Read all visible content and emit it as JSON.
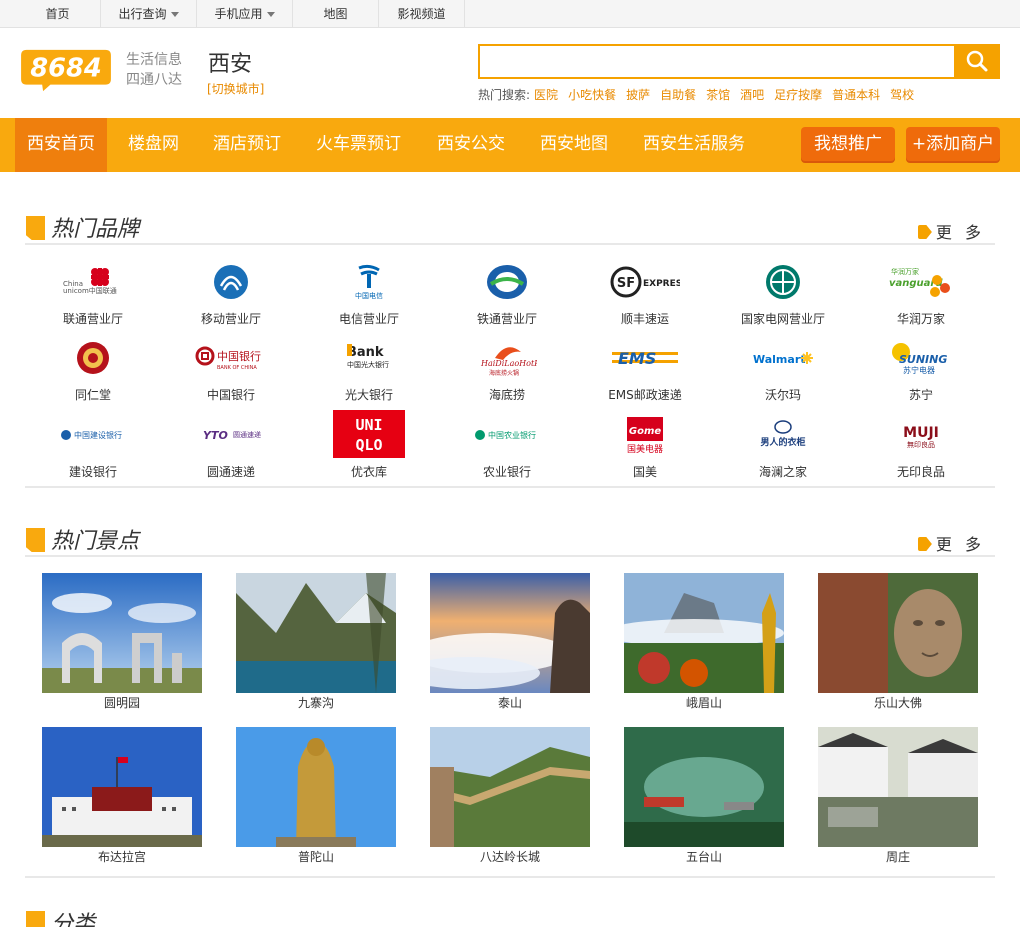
{
  "topbar": {
    "items": [
      {
        "label": "首页",
        "dropdown": false
      },
      {
        "label": "出行查询",
        "dropdown": true
      },
      {
        "label": "手机应用",
        "dropdown": true
      },
      {
        "label": "地图",
        "dropdown": false
      },
      {
        "label": "影视频道",
        "dropdown": false
      }
    ]
  },
  "header": {
    "logo_text": "8684",
    "slogan_line1": "生活信息",
    "slogan_line2": "四通八达",
    "city": "西安",
    "switch_city": "[切换城市]",
    "search_value": "",
    "hot_label": "热门搜索:",
    "hot_links": [
      "医院",
      "小吃快餐",
      "披萨",
      "自助餐",
      "茶馆",
      "酒吧",
      "足疗按摩",
      "普通本科",
      "驾校"
    ]
  },
  "nav": {
    "items": [
      "西安首页",
      "楼盘网",
      "酒店预订",
      "火车票预订",
      "西安公交",
      "西安地图",
      "西安生活服务"
    ],
    "promote_label": "我想推广",
    "add_merchant_label": "+添加商户"
  },
  "brands_section": {
    "title": "热门品牌",
    "more": "更 多",
    "items": [
      {
        "label": "联通营业厅",
        "logo": "China unicom中国联通"
      },
      {
        "label": "移动营业厅",
        "logo": "mobile-logo"
      },
      {
        "label": "电信营业厅",
        "logo": "中国电信"
      },
      {
        "label": "铁通营业厅",
        "logo": "tietong-logo"
      },
      {
        "label": "顺丰速运",
        "logo": "SF EXPRESS"
      },
      {
        "label": "国家电网营业厅",
        "logo": "state-grid-logo"
      },
      {
        "label": "华润万家",
        "logo": "华润万家 vanguard"
      },
      {
        "label": "同仁堂",
        "logo": "tongrentang-logo"
      },
      {
        "label": "中国银行",
        "logo": "中国银行"
      },
      {
        "label": "光大银行",
        "logo": "Bank"
      },
      {
        "label": "海底捞",
        "logo": "haidilao-logo"
      },
      {
        "label": "EMS邮政速递",
        "logo": "EMS"
      },
      {
        "label": "沃尔玛",
        "logo": "Walmart"
      },
      {
        "label": "苏宁",
        "logo": "SUNING 苏宁电器"
      },
      {
        "label": "建设银行",
        "logo": "中国建设银行"
      },
      {
        "label": "圆通速递",
        "logo": "YTO 圆通速递"
      },
      {
        "label": "优衣库",
        "logo": "UNI QLO"
      },
      {
        "label": "农业银行",
        "logo": "中国农业银行"
      },
      {
        "label": "国美",
        "logo": "GOME 国美电器"
      },
      {
        "label": "海澜之家",
        "logo": "男人的衣柜"
      },
      {
        "label": "无印良品",
        "logo": "MUJI 無印良品"
      }
    ]
  },
  "spots_section": {
    "title": "热门景点",
    "more": "更 多",
    "items": [
      {
        "label": "圆明园"
      },
      {
        "label": "九寨沟"
      },
      {
        "label": "泰山"
      },
      {
        "label": "峨眉山"
      },
      {
        "label": "乐山大佛"
      },
      {
        "label": "布达拉宫"
      },
      {
        "label": "普陀山"
      },
      {
        "label": "八达岭长城"
      },
      {
        "label": "五台山"
      },
      {
        "label": "周庄"
      }
    ]
  },
  "category_section": {
    "title": "分类"
  },
  "colors": {
    "accent": "#f9a90e",
    "accent_dark": "#ef7f0d",
    "link": "#e88a00"
  }
}
